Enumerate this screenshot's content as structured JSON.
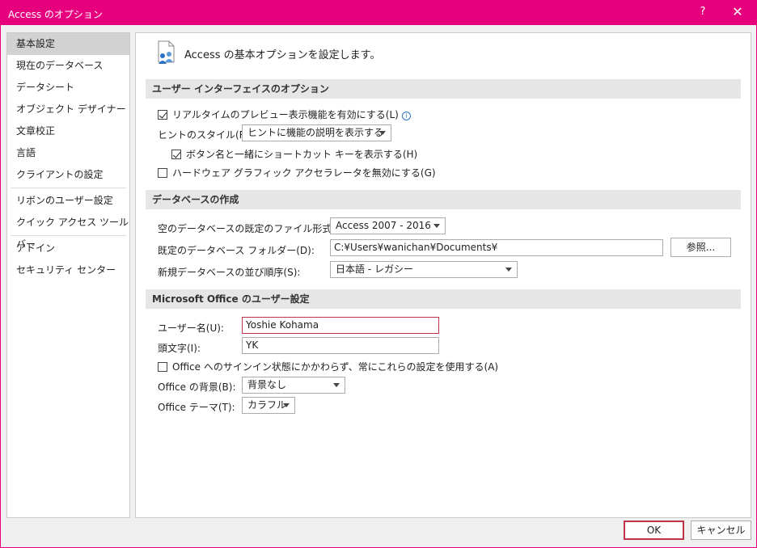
{
  "window": {
    "title": "Access のオプション",
    "help": "?",
    "close": "✕"
  },
  "nav": {
    "items": [
      {
        "label": "基本設定"
      },
      {
        "label": "現在のデータベース"
      },
      {
        "label": "データシート"
      },
      {
        "label": "オブジェクト デザイナー"
      },
      {
        "label": "文章校正"
      },
      {
        "label": "言語"
      },
      {
        "label": "クライアントの設定"
      },
      {
        "label": "リボンのユーザー設定"
      },
      {
        "label": "クイック アクセス ツール バー"
      },
      {
        "label": "アドイン"
      },
      {
        "label": "セキュリティ センター"
      }
    ],
    "selected": "基本設定"
  },
  "header": {
    "text": "Access の基本オプションを設定します。",
    "icon": "options-people-icon"
  },
  "ui_options": {
    "title": "ユーザー インターフェイスのオプション",
    "live_preview": {
      "label": "リアルタイムのプレビュー表示機能を有効にする(L)",
      "checked": true,
      "info": "i"
    },
    "tooltip_style": {
      "label": "ヒントのスタイル(R):",
      "value": "ヒントに機能の説明を表示する"
    },
    "shortcut_keys": {
      "label": "ボタン名と一緒にショートカット キーを表示する(H)",
      "checked": true
    },
    "hw_accel": {
      "label": "ハードウェア グラフィック アクセラレータを無効にする(G)",
      "checked": false
    }
  },
  "db_create": {
    "title": "データベースの作成",
    "file_format": {
      "label": "空のデータベースの既定のファイル形式(F):",
      "value": "Access 2007 - 2016"
    },
    "folder": {
      "label": "既定のデータベース フォルダー(D):",
      "value": "C:¥Users¥wanichan¥Documents¥",
      "browse": "参照..."
    },
    "sort_order": {
      "label": "新規データベースの並び順序(S):",
      "value": "日本語 - レガシー"
    }
  },
  "office": {
    "title": "Microsoft Office のユーザー設定",
    "username": {
      "label": "ユーザー名(U):",
      "value": "Yoshie Kohama"
    },
    "initials": {
      "label": "頭文字(I):",
      "value": "YK"
    },
    "always_use": {
      "label": "Office へのサインイン状態にかかわらず、常にこれらの設定を使用する(A)",
      "checked": false
    },
    "background": {
      "label": "Office の背景(B):",
      "value": "背景なし"
    },
    "theme": {
      "label": "Office テーマ(T):",
      "value": "カラフル"
    }
  },
  "footer": {
    "ok": "OK",
    "cancel": "キャンセル"
  },
  "colors": {
    "accent": "#e6007e",
    "focus": "#c2314a"
  }
}
